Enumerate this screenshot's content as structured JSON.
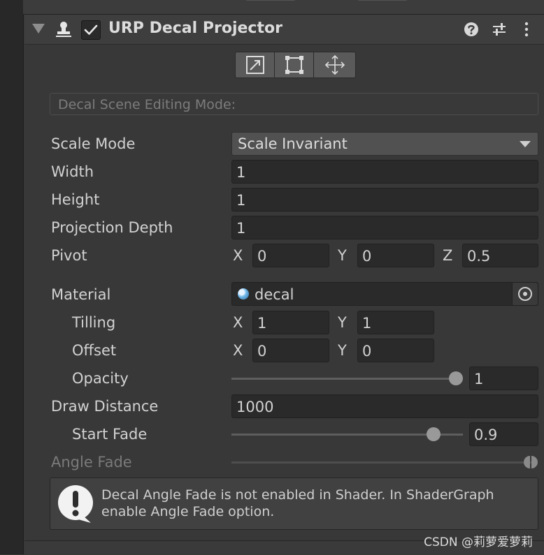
{
  "component": {
    "title": "URP Decal Projector",
    "enabled": true
  },
  "icons": {
    "header": [
      "foldout-arrow-icon",
      "decal-projector-icon",
      "checkbox-check-icon",
      "help-icon",
      "preset-sliders-icon",
      "kebab-menu-icon"
    ],
    "tools": [
      "edit-uv-pivot-icon",
      "edit-bounds-icon",
      "move-pivot-icon"
    ],
    "object_picker": "object-picker-target-icon",
    "help_box": "warning-exclamation-icon"
  },
  "editing_mode": {
    "label": "Decal Scene Editing Mode:"
  },
  "scale_mode": {
    "label": "Scale Mode",
    "value": "Scale Invariant"
  },
  "width": {
    "label": "Width",
    "value": "1"
  },
  "height": {
    "label": "Height",
    "value": "1"
  },
  "projection_depth": {
    "label": "Projection Depth",
    "value": "1"
  },
  "pivot": {
    "label": "Pivot",
    "x_label": "X",
    "x": "0",
    "y_label": "Y",
    "y": "0",
    "z_label": "Z",
    "z": "0.5"
  },
  "material": {
    "label": "Material",
    "value": "decal"
  },
  "tilling": {
    "label": "Tilling",
    "x_label": "X",
    "x": "1",
    "y_label": "Y",
    "y": "1"
  },
  "offset": {
    "label": "Offset",
    "x_label": "X",
    "x": "0",
    "y_label": "Y",
    "y": "0"
  },
  "opacity": {
    "label": "Opacity",
    "value": "1",
    "level": 1.0
  },
  "draw_distance": {
    "label": "Draw Distance",
    "value": "1000"
  },
  "start_fade": {
    "label": "Start Fade",
    "value": "0.9",
    "level": 0.9
  },
  "angle_fade": {
    "label": "Angle Fade",
    "min_level": 1.0,
    "max_level": 1.0
  },
  "help_box": {
    "text": "Decal Angle Fade is not enabled in Shader. In ShaderGraph\nenable Angle Fade option."
  },
  "watermark": "CSDN @莉萝爱萝莉",
  "colors": {
    "background": "#383838",
    "field": "#2a2a2a",
    "dropdown": "#515151",
    "text": "#d2d2d2",
    "muted_text": "#7a7a7a",
    "slider_thumb": "#999999"
  }
}
